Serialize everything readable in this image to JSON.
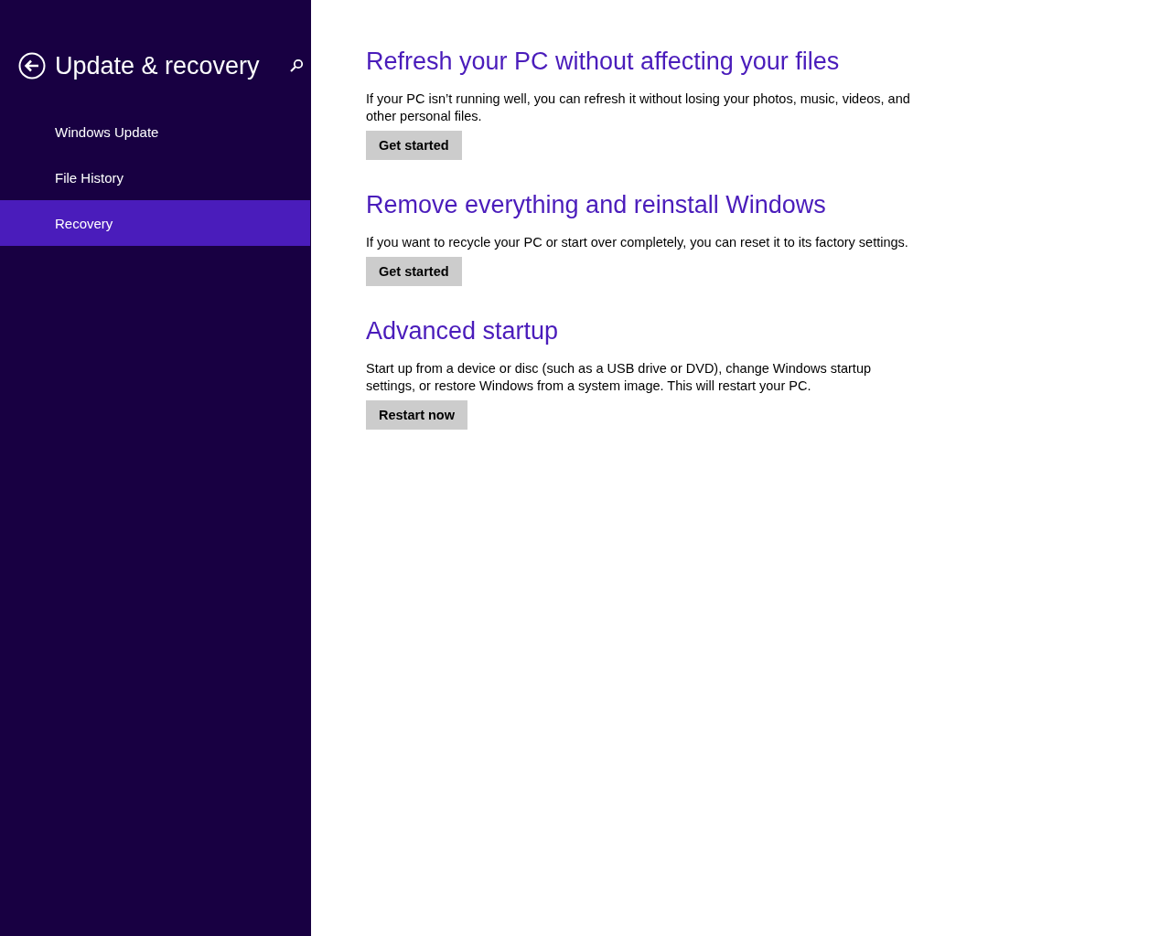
{
  "sidebar": {
    "title": "Update & recovery",
    "items": [
      {
        "label": "Windows Update",
        "selected": false
      },
      {
        "label": "File History",
        "selected": false
      },
      {
        "label": "Recovery",
        "selected": true
      }
    ]
  },
  "sections": [
    {
      "heading": "Refresh your PC without affecting your files",
      "description": "If your PC isn’t running well, you can refresh it without losing your photos, music, videos, and other personal files.",
      "button": "Get started"
    },
    {
      "heading": "Remove everything and reinstall Windows",
      "description": "If you want to recycle your PC or start over completely, you can reset it to its factory settings.",
      "button": "Get started"
    },
    {
      "heading": "Advanced startup",
      "description": "Start up from a device or disc (such as a USB drive or DVD), change Windows startup settings, or restore Windows from a system image. This will restart your PC.",
      "button": "Restart now"
    }
  ]
}
